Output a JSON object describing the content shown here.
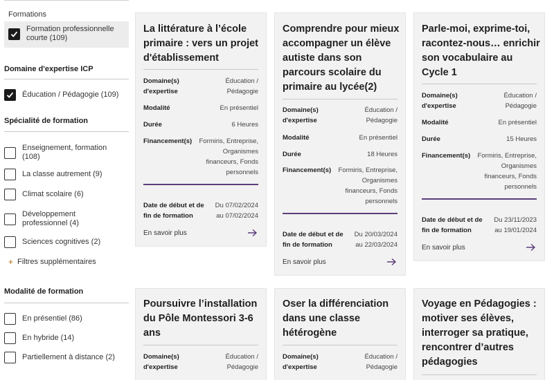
{
  "sidebar": {
    "formations": {
      "label": "Formations",
      "item": "Formation professionnelle courte (109)"
    },
    "domaine": {
      "title": "Domaine d'expertise ICP",
      "item": "Éducation / Pédagogie (109)"
    },
    "specialite": {
      "title": "Spécialité de formation",
      "items": [
        "Enseignement, formation (108)",
        "La classe autrement (9)",
        "Climat scolaire (6)",
        "Développement professionnel (4)",
        "Sciences cognitives (2)"
      ],
      "more": "Filtres supplémentaires"
    },
    "modalite": {
      "title": "Modalité de formation",
      "items": [
        "En présentiel (86)",
        "En hybride (14)",
        "Partiellement à distance (2)"
      ]
    }
  },
  "labels": {
    "domaine": "Domaine(s) d'expertise",
    "modalite": "Modalité",
    "duree": "Durée",
    "financement": "Financement(s)",
    "dates": "Date de début et de fin de formation",
    "more": "En savoir plus"
  },
  "cards": [
    {
      "title": "La littérature à l’école primaire : vers un projet d'établissement",
      "domaine": "Éducation / Pédagogie",
      "modalite": "En présentiel",
      "duree": "6 Heures",
      "financement": "Formiris, Entreprise, Organismes financeurs, Fonds personnels",
      "dates": "Du 07/02/2024 au 07/02/2024"
    },
    {
      "title": "Comprendre pour mieux accompagner un élève autiste dans son parcours scolaire du primaire au lycée(2)",
      "domaine": "Éducation / Pédagogie",
      "modalite": "En présentiel",
      "duree": "18 Heures",
      "financement": "Formiris, Entreprise, Organismes financeurs, Fonds personnels",
      "dates": "Du 20/03/2024 au 22/03/2024"
    },
    {
      "title": "Parle-moi, exprime-toi, racontez-nous… enrichir son vocabulaire au Cycle 1",
      "domaine": "Éducation / Pédagogie",
      "modalite": "En présentiel",
      "duree": "15 Heures",
      "financement": "Formiris, Entreprise, Organismes financeurs, Fonds personnels",
      "dates": "Du 23/11/2023 au 19/01/2024"
    },
    {
      "title": "Poursuivre l’installation du Pôle Montessori 3-6 ans",
      "domaine": "Éducation / Pédagogie"
    },
    {
      "title": "Oser la différenciation dans une classe hétérogène",
      "domaine": "Éducation / Pédagogie"
    },
    {
      "title": "Voyage en Pédagogies : motiver ses élèves, interroger sa pratique, rencontrer d’autres pédagogies"
    }
  ],
  "colors": {
    "accent_rule": "#5a3d7a",
    "card_bg": "#f2f2f2",
    "plus_icon": "#b06a00"
  }
}
